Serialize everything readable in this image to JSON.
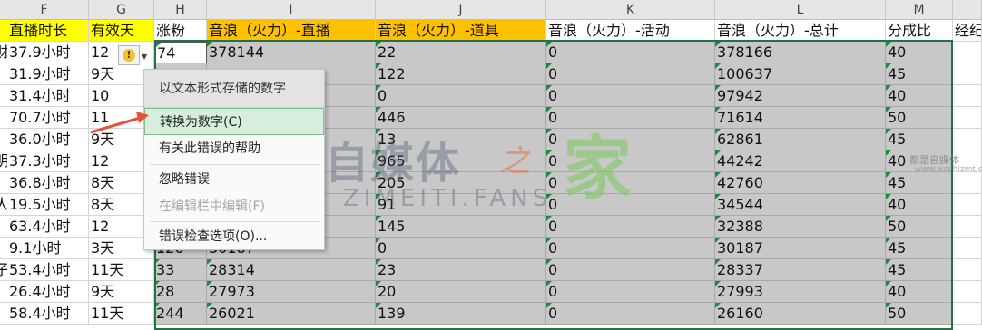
{
  "columns": [
    "F",
    "G",
    "H",
    "I",
    "J",
    "K",
    "L",
    "M"
  ],
  "headers": [
    "直播时长",
    "有效天",
    "涨粉",
    "音浪（火力）-直播",
    "音浪（火力）-道具",
    "音浪（火力）-活动",
    "音浪（火力）-总计",
    "分成比",
    "经纪"
  ],
  "left_fragments": [
    "财",
    "-",
    "",
    "",
    "",
    "明",
    "",
    "人",
    "",
    "",
    "子",
    "",
    ""
  ],
  "rows": [
    [
      "37.9小时",
      "12",
      "74",
      "378144",
      "22",
      "0",
      "378166",
      "40"
    ],
    [
      "31.9小时",
      "9天",
      "",
      "",
      "122",
      "0",
      "100637",
      "45"
    ],
    [
      "31.4小时",
      "10",
      "",
      "",
      "0",
      "0",
      "97942",
      "40"
    ],
    [
      "70.7小时",
      "11",
      "",
      "",
      "446",
      "0",
      "71614",
      "50"
    ],
    [
      "36.0小时",
      "9天",
      "",
      "",
      "13",
      "0",
      "62861",
      "45"
    ],
    [
      "37.3小时",
      "12",
      "",
      "",
      "965",
      "0",
      "44242",
      "40"
    ],
    [
      "36.8小时",
      "8天",
      "",
      "",
      "205",
      "0",
      "42760",
      "45"
    ],
    [
      "19.5小时",
      "8天",
      "",
      "",
      "91",
      "0",
      "34544",
      "40"
    ],
    [
      "63.4小时",
      "12",
      "",
      "",
      "145",
      "0",
      "32388",
      "50"
    ],
    [
      "9.1小时",
      "3天",
      "126",
      "30187",
      "0",
      "0",
      "30187",
      "45"
    ],
    [
      "53.4小时",
      "11天",
      "33",
      "28314",
      "23",
      "0",
      "28337",
      "45"
    ],
    [
      "26.4小时",
      "9天",
      "28",
      "27973",
      "20",
      "0",
      "27993",
      "40"
    ],
    [
      "58.4小时",
      "11天",
      "244",
      "26021",
      "139",
      "0",
      "26160",
      "50"
    ]
  ],
  "warning_icon": "!",
  "menu": {
    "title": "以文本形式存储的数字",
    "items": [
      "转换为数字(C)",
      "有关此错误的帮助",
      "忽略错误",
      "在编辑栏中编辑(F)",
      "错误检查选项(O)..."
    ]
  },
  "watermark": {
    "main": "自媒体",
    "zhi": "之",
    "jia": "家",
    "sub": "ZIMEITI.FANS",
    "small1": "都是自媒体",
    "small2": "www.woshizmt.cn"
  },
  "colors": {
    "header_yellow": "#ffff00",
    "header_orange": "#ffc000",
    "selection_gray": "#c8c8c8",
    "menu_highlight": "#d6efdc",
    "arrow_red": "#e8503a",
    "excel_green": "#217346"
  }
}
